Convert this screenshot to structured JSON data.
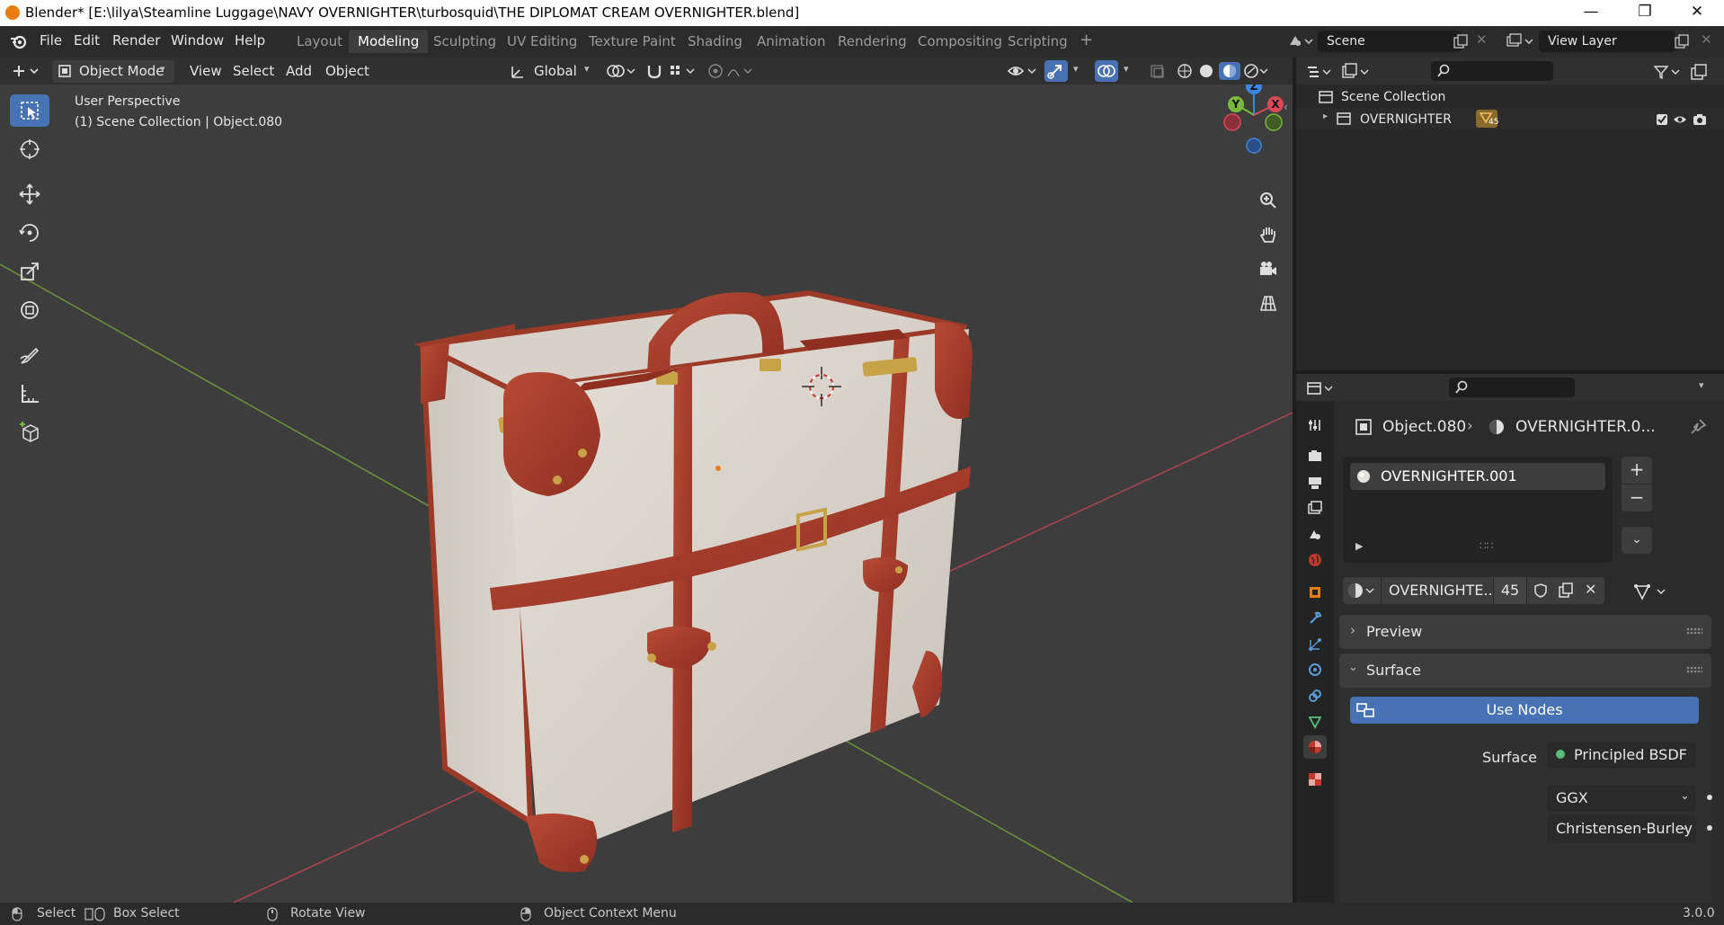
{
  "window": {
    "title": "Blender* [E:\\lilya\\Steamline Luggage\\NAVY OVERNIGHTER\\turbosquid\\THE DIPLOMAT CREAM OVERNIGHTER.blend]",
    "minimize": "—",
    "maximize": "❐",
    "close": "✕"
  },
  "menu": {
    "items": [
      "File",
      "Edit",
      "Render",
      "Window",
      "Help"
    ]
  },
  "workspaces": [
    "Layout",
    "Modeling",
    "Sculpting",
    "UV Editing",
    "Texture Paint",
    "Shading",
    "Animation",
    "Rendering",
    "Compositing",
    "Scripting"
  ],
  "workspace_add": "+",
  "scene": {
    "name": "Scene"
  },
  "view_layer": {
    "name": "View Layer"
  },
  "viewport_header": {
    "mode": "Object Mode",
    "menus": [
      "View",
      "Select",
      "Add",
      "Object"
    ],
    "orientation": "Global"
  },
  "viewport": {
    "perspective": "User Perspective",
    "context": "(1) Scene Collection | Object.080",
    "gizmo_axes": [
      "Z",
      "Y",
      "X"
    ]
  },
  "outliner": {
    "root": "Scene Collection",
    "collection": "OVERNIGHTER",
    "child_count": "45"
  },
  "properties": {
    "object_name": "Object.080",
    "material_name": "OVERNIGHTER.0...",
    "slot_material": "OVERNIGHTER.001",
    "datablock_name": "OVERNIGHTE...",
    "user_count": "45",
    "preview_label": "Preview",
    "surface_label": "Surface",
    "use_nodes_label": "Use Nodes",
    "surface_field_label": "Surface",
    "surface_shader": "Principled BSDF",
    "distribution": "GGX",
    "subsurface_method": "Christensen-Burley"
  },
  "statusbar": {
    "select": "Select",
    "box_select": "Box Select",
    "rotate_view": "Rotate View",
    "context_menu": "Object Context Menu",
    "version": "3.0.0"
  },
  "colors": {
    "accent_blue": "#4772b3",
    "viewport_bg": "#3d3d3d",
    "axis_x": "#d94a56",
    "axis_y": "#7ab83a",
    "axis_z": "#3c87e0",
    "leather": "#a63a2a",
    "case_cream": "#dcd6cf",
    "brass": "#c8a247"
  },
  "icons": [
    "blender-logo-icon",
    "select-box-icon",
    "cursor-icon",
    "move-icon",
    "rotate-icon",
    "scale-icon",
    "transform-icon",
    "annotate-icon",
    "measure-icon",
    "add-cube-icon",
    "zoom-icon",
    "hand-pan-icon",
    "camera-icon",
    "grid-ortho-icon",
    "material-sphere-icon",
    "shield-fake-user-icon"
  ]
}
